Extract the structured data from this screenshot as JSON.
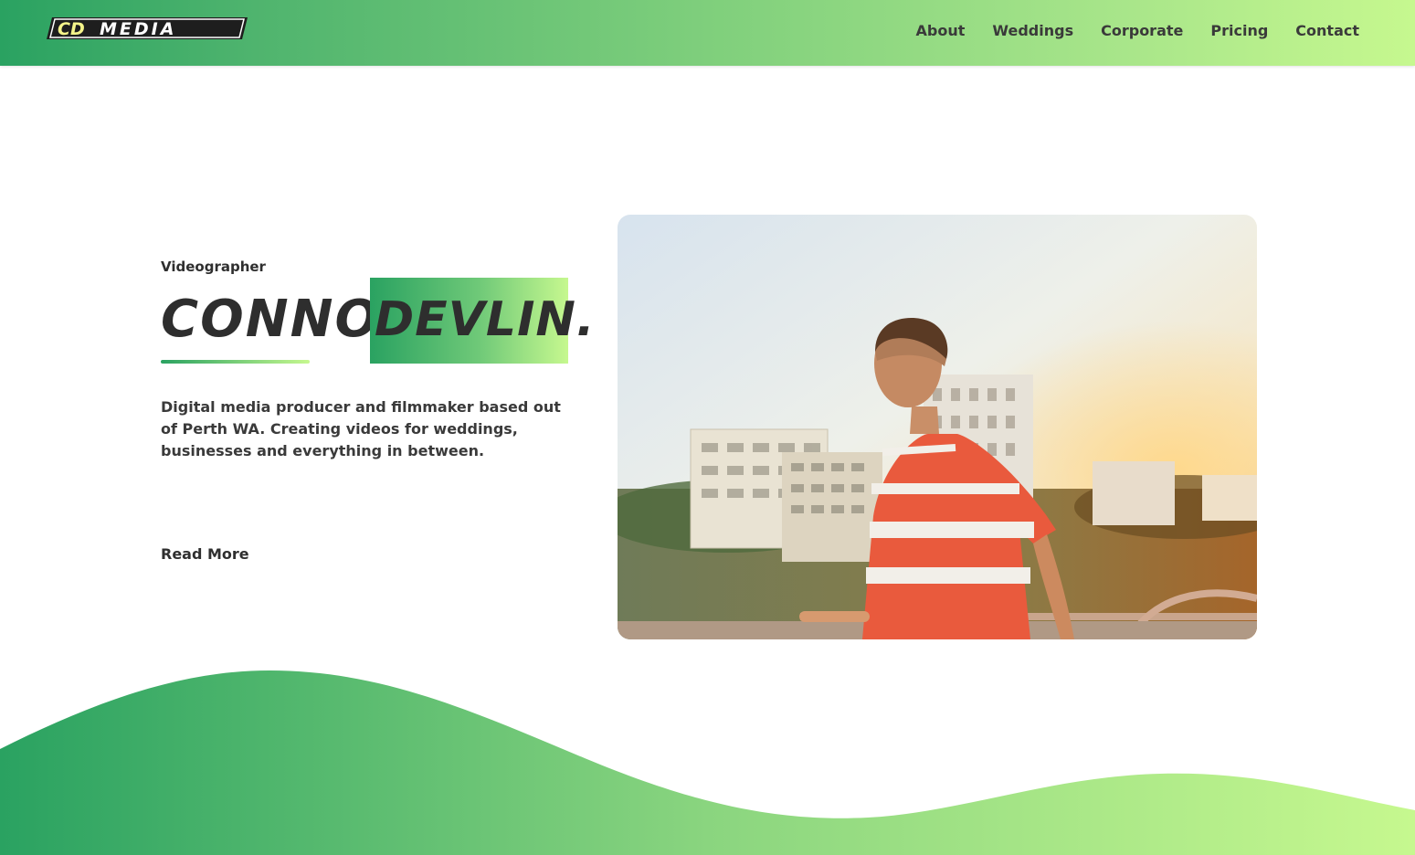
{
  "header": {
    "logo_text": "CDMEDIA",
    "nav": [
      "About",
      "Weddings",
      "Corporate",
      "Pricing",
      "Contact"
    ]
  },
  "hero": {
    "eyebrow": "Videographer",
    "title_first": "CONNOR",
    "title_last": "DEVLIN.",
    "description": "Digital media producer and filmmaker based out of Perth WA. Creating videos for weddings, businesses and everything in between.",
    "cta": "Read More"
  },
  "colors": {
    "gradient_start": "#2aa261",
    "gradient_end": "#c6f88f",
    "text": "#2f2f2f",
    "logo_fill": "#f4f48a"
  },
  "icons": {
    "photo": "person-on-rooftop-sunset-image"
  }
}
